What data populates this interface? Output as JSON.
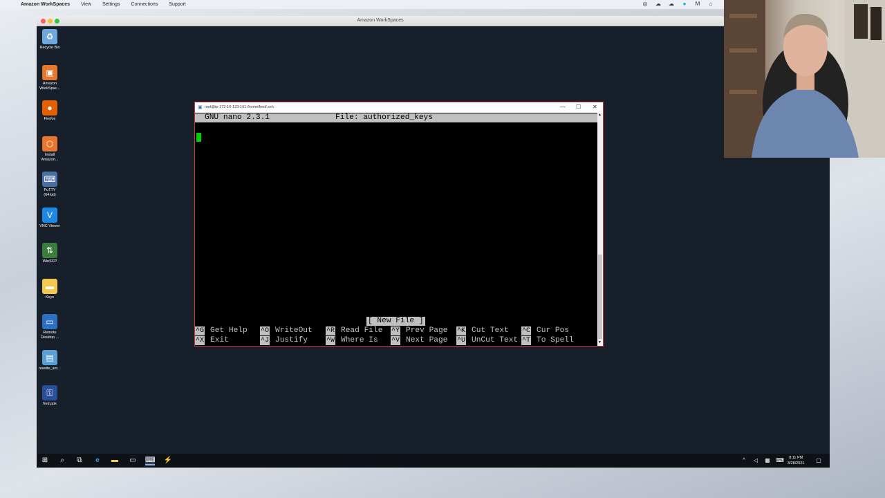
{
  "mac_menubar": {
    "app_name": "Amazon WorkSpaces",
    "items": [
      "View",
      "Settings",
      "Connections",
      "Support"
    ]
  },
  "workspaces_window": {
    "title": "Amazon WorkSpaces"
  },
  "desktop_icons": [
    {
      "label": "Recycle Bin",
      "icon": "recycle-bin-icon",
      "color": "#6fa8dc"
    },
    {
      "label": "Amazon\nWorkSpac...",
      "icon": "workspaces-icon",
      "color": "#e8772e"
    },
    {
      "label": "Firefox",
      "icon": "firefox-icon",
      "color": "#e66000"
    },
    {
      "label": "Install\nAmazon...",
      "icon": "install-icon",
      "color": "#e8772e"
    },
    {
      "label": "PuTTY\n(64-bit)",
      "icon": "putty-icon",
      "color": "#4a6fa5"
    },
    {
      "label": "VNC Viewer",
      "icon": "vnc-icon",
      "color": "#1e88e5"
    },
    {
      "label": "WinSCP",
      "icon": "winscp-icon",
      "color": "#3b7d3b"
    },
    {
      "label": "Keys",
      "icon": "folder-icon",
      "color": "#f2c94c"
    },
    {
      "label": "Remote\nDesktop ...",
      "icon": "remote-desktop-icon",
      "color": "#2f6fc0"
    },
    {
      "label": "rewrite_am...",
      "icon": "script-icon",
      "color": "#5a9fd6"
    },
    {
      "label": "fred.ppk",
      "icon": "key-file-icon",
      "color": "#2a4f9a"
    }
  ],
  "putty": {
    "title": "root@ip-172-16-123-161:/home/fred/.ssh",
    "nano_version": "GNU nano 2.3.1",
    "file_label": "File: authorized_keys",
    "status": "[ New File ]",
    "shortcuts_row1": [
      {
        "key": "^G",
        "label": "Get Help"
      },
      {
        "key": "^O",
        "label": "WriteOut"
      },
      {
        "key": "^R",
        "label": "Read File"
      },
      {
        "key": "^Y",
        "label": "Prev Page"
      },
      {
        "key": "^K",
        "label": "Cut Text"
      },
      {
        "key": "^C",
        "label": "Cur Pos"
      }
    ],
    "shortcuts_row2": [
      {
        "key": "^X",
        "label": "Exit"
      },
      {
        "key": "^J",
        "label": "Justify"
      },
      {
        "key": "^W",
        "label": "Where Is"
      },
      {
        "key": "^V",
        "label": "Next Page"
      },
      {
        "key": "^U",
        "label": "UnCut Text"
      },
      {
        "key": "^T",
        "label": "To Spell"
      }
    ]
  },
  "taskbar": {
    "time": "8:11 PM",
    "date": "3/28/2021"
  },
  "colors": {
    "desktop": "#17202a",
    "taskbar": "#0e1115",
    "cursor": "#00d000",
    "putty_border": "#cc3b3b"
  }
}
